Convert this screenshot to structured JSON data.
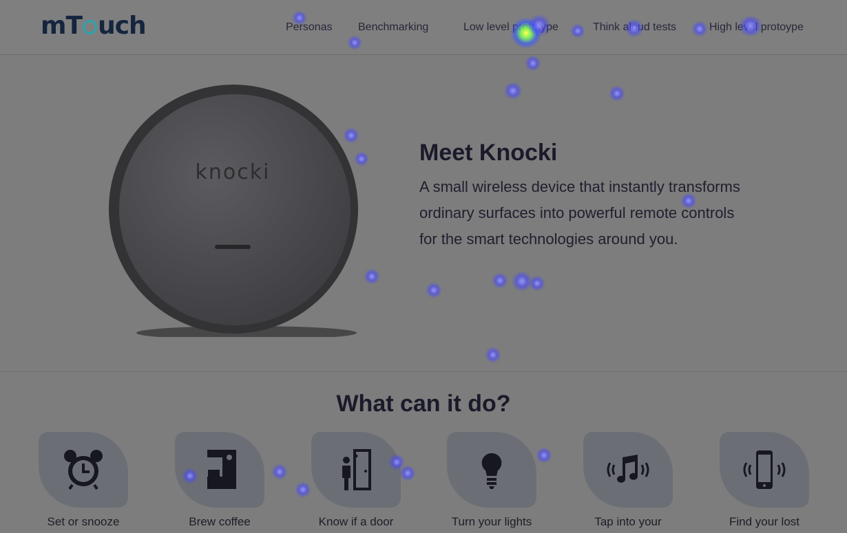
{
  "header": {
    "logo_prefix": "mT",
    "logo_suffix": "uch",
    "nav": [
      {
        "label": "Personas"
      },
      {
        "label": "Benchmarking"
      },
      {
        "label": "Low level prototype"
      },
      {
        "label": "Think aloud tests"
      },
      {
        "label": "High level protoype"
      }
    ]
  },
  "hero": {
    "device_brand": "knocki",
    "title": "Meet Knocki",
    "description": "A small wireless device that instantly transforms ordinary surfaces into powerful remote controls for the smart technologies around you."
  },
  "features": {
    "title": "What can it do?",
    "items": [
      {
        "label": "Set or snooze",
        "icon": "alarm-clock-icon"
      },
      {
        "label": "Brew coffee",
        "icon": "coffee-maker-icon"
      },
      {
        "label": "Know if a door",
        "icon": "door-knock-icon"
      },
      {
        "label": "Turn your lights",
        "icon": "lightbulb-icon"
      },
      {
        "label": "Tap into your",
        "icon": "music-icon"
      },
      {
        "label": "Find your lost",
        "icon": "phone-vibrate-icon"
      }
    ]
  },
  "colors": {
    "logo_text": "#15253f",
    "logo_accent": "#2ba4b0",
    "overlay_bg": "#7d7d7d",
    "icon_blob": "#6b6e75"
  }
}
